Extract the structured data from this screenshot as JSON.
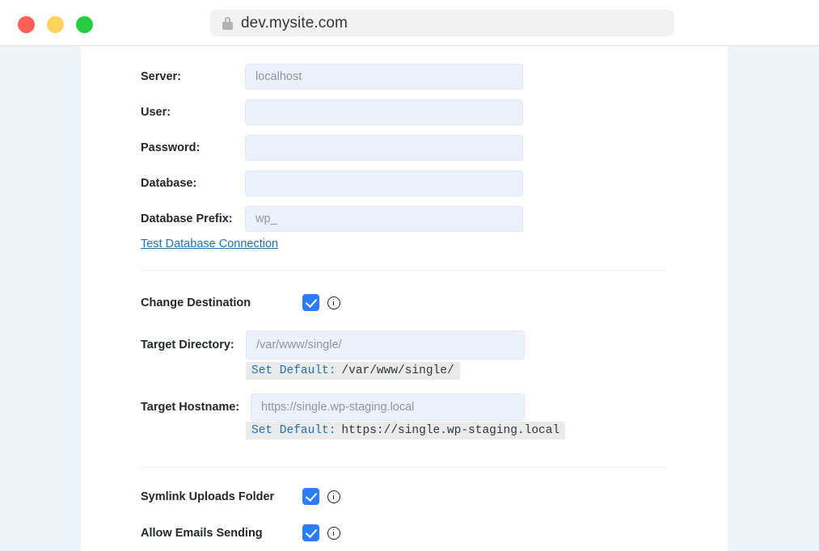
{
  "browser": {
    "window_controls": [
      {
        "name": "close",
        "color": "#ff5f57"
      },
      {
        "name": "minimize",
        "color": "#ffd35c"
      },
      {
        "name": "maximize",
        "color": "#28cd41"
      }
    ],
    "lock_icon": "lock-icon",
    "url": "dev.mysite.com"
  },
  "colors": {
    "page_background": "#eef3f8",
    "card_background": "#ffffff",
    "input_background": "#ecf1fc",
    "accent_blue": "#2b7cff",
    "link_blue": "#2271b1",
    "label_text": "#23282d",
    "code_band": "#eaeaea"
  },
  "form": {
    "database_fields": [
      {
        "label": "Server:",
        "value": "",
        "placeholder": "localhost"
      },
      {
        "label": "User:",
        "value": "",
        "placeholder": ""
      },
      {
        "label": "Password:",
        "value": "",
        "placeholder": ""
      },
      {
        "label": "Database:",
        "value": "",
        "placeholder": ""
      },
      {
        "label": "Database Prefix:",
        "value": "",
        "placeholder": "wp_"
      }
    ],
    "test_connection_link": "Test Database Connection",
    "change_destination": {
      "label": "Change Destination",
      "checked": true,
      "info_icon": "info-icon"
    },
    "target_directory": {
      "label": "Target Directory:",
      "value": "",
      "placeholder": "/var/www/single/",
      "set_default_link": "Set Default:",
      "set_default_value": "/var/www/single/"
    },
    "target_hostname": {
      "label": "Target Hostname:",
      "value": "",
      "placeholder": "https://single.wp-staging.local",
      "set_default_link": "Set Default:",
      "set_default_value": "https://single.wp-staging.local"
    },
    "toggles": [
      {
        "label": "Symlink Uploads Folder",
        "checked": true,
        "info_icon": "info-icon"
      },
      {
        "label": "Allow Emails Sending",
        "checked": true,
        "info_icon": "info-icon"
      }
    ]
  }
}
